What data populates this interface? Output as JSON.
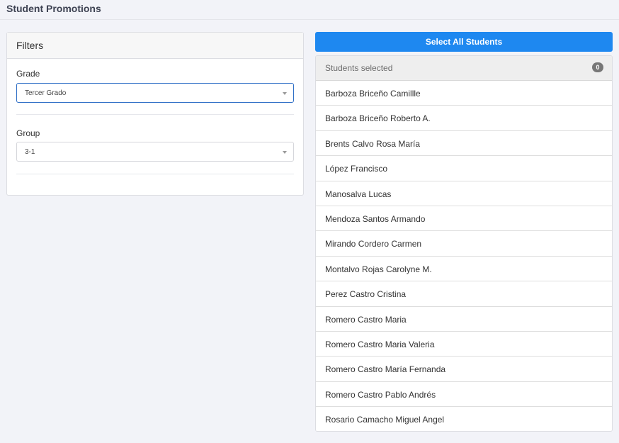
{
  "page": {
    "title": "Student Promotions"
  },
  "filters": {
    "title": "Filters",
    "grade": {
      "label": "Grade",
      "value": "Tercer Grado"
    },
    "group": {
      "label": "Group",
      "value": "3-1"
    }
  },
  "students": {
    "select_all_label": "Select All Students",
    "selected_label": "Students selected",
    "selected_count": "0",
    "items": [
      "Barboza Briceño Camillle",
      "Barboza Briceño Roberto A.",
      "Brents Calvo Rosa María",
      "López Francisco",
      "Manosalva Lucas",
      "Mendoza Santos Armando",
      "Mirando Cordero Carmen",
      "Montalvo Rojas Carolyne M.",
      "Perez Castro Cristina",
      "Romero Castro Maria",
      "Romero Castro Maria Valeria",
      "Romero Castro María Fernanda",
      "Romero Castro Pablo Andrés",
      "Rosario Camacho Miguel Angel"
    ]
  },
  "colors": {
    "accent": "#1e88f0",
    "background": "#f2f3f8",
    "badge": "#777777"
  }
}
